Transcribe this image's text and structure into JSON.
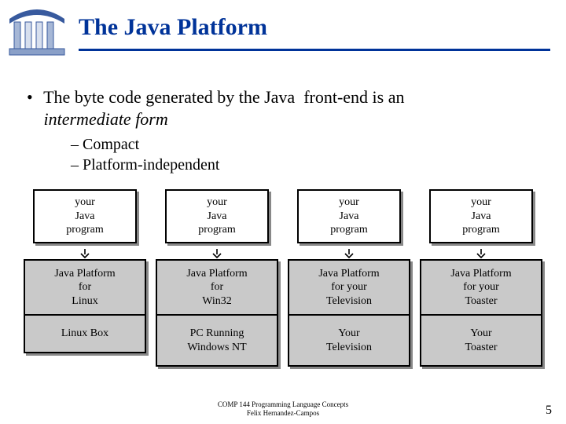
{
  "title": "The Java Platform",
  "bullets": {
    "main_a": "The byte code generated by the Java",
    "main_b": "front-end is an",
    "main_ital": "intermediate form",
    "subs": [
      "Compact",
      "Platform-independent"
    ]
  },
  "columns": [
    {
      "program_l1": "your",
      "program_l2": "Java",
      "program_l3": "program",
      "platform_l1": "Java Platform",
      "platform_l2": "for",
      "platform_l3": "Linux",
      "host_l1": "Linux Box",
      "host_l2": ""
    },
    {
      "program_l1": "your",
      "program_l2": "Java",
      "program_l3": "program",
      "platform_l1": "Java Platform",
      "platform_l2": "for",
      "platform_l3": "Win32",
      "host_l1": "PC Running",
      "host_l2": "Windows NT"
    },
    {
      "program_l1": "your",
      "program_l2": "Java",
      "program_l3": "program",
      "platform_l1": "Java Platform",
      "platform_l2": "for your",
      "platform_l3": "Television",
      "host_l1": "Your",
      "host_l2": "Television"
    },
    {
      "program_l1": "your",
      "program_l2": "Java",
      "program_l3": "program",
      "platform_l1": "Java Platform",
      "platform_l2": "for your",
      "platform_l3": "Toaster",
      "host_l1": "Your",
      "host_l2": "Toaster"
    }
  ],
  "footer": {
    "line1": "COMP 144 Programming Language Concepts",
    "line2": "Felix Hernandez-Campos"
  },
  "page_number": "5"
}
